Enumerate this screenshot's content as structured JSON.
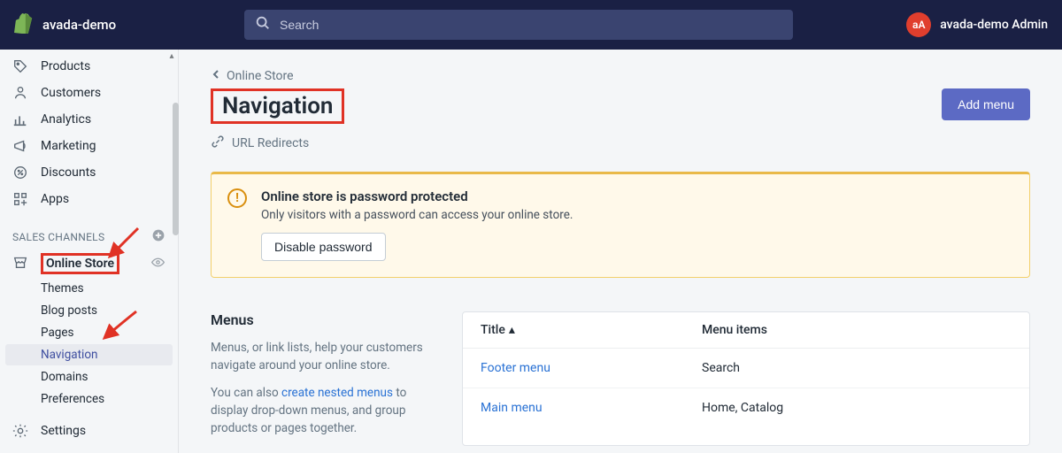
{
  "header": {
    "brand": "avada-demo",
    "search_placeholder": "Search",
    "avatar_initials": "aA",
    "username": "avada-demo Admin"
  },
  "sidebar": {
    "items": [
      {
        "label": "Products"
      },
      {
        "label": "Customers"
      },
      {
        "label": "Analytics"
      },
      {
        "label": "Marketing"
      },
      {
        "label": "Discounts"
      },
      {
        "label": "Apps"
      }
    ],
    "channels_header": "SALES CHANNELS",
    "channel_label": "Online Store",
    "sub": [
      {
        "label": "Themes"
      },
      {
        "label": "Blog posts"
      },
      {
        "label": "Pages"
      },
      {
        "label": "Navigation"
      },
      {
        "label": "Domains"
      },
      {
        "label": "Preferences"
      }
    ],
    "settings": "Settings"
  },
  "breadcrumb": "Online Store",
  "page_title": "Navigation",
  "add_menu": "Add menu",
  "url_redirects": "URL Redirects",
  "banner": {
    "title": "Online store is password protected",
    "text": "Only visitors with a password can access your online store.",
    "button": "Disable password"
  },
  "menus_section": {
    "heading": "Menus",
    "p1_a": "Menus, or link lists, help your customers navigate around your online store.",
    "p2_a": "You can also ",
    "p2_link": "create nested menus",
    "p2_b": " to display drop-down menus, and group products or pages together."
  },
  "table": {
    "col_title": "Title",
    "col_items": "Menu items",
    "rows": [
      {
        "title": "Footer menu",
        "items": "Search"
      },
      {
        "title": "Main menu",
        "items": "Home, Catalog"
      }
    ]
  }
}
